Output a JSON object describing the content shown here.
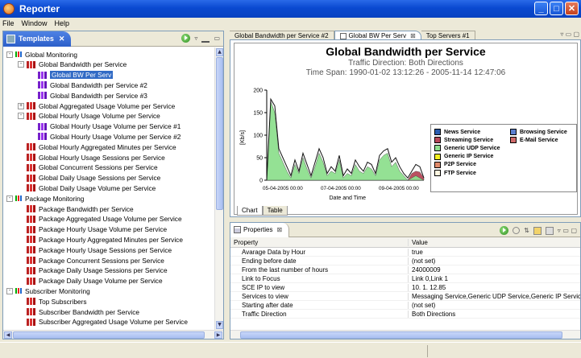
{
  "window": {
    "title": "Reporter"
  },
  "menu": [
    "File",
    "Window",
    "Help"
  ],
  "templates_panel": {
    "tab_label": "Templates",
    "tree": [
      {
        "label": "Global Monitoring",
        "level": 0,
        "icon": "folder",
        "expander": "-"
      },
      {
        "label": "Global Bandwidth per Service",
        "level": 1,
        "icon": "bar",
        "expander": "-"
      },
      {
        "label": "Global BW Per Serv",
        "level": 2,
        "icon": "violet",
        "selected": true
      },
      {
        "label": "Global Bandwidth per Service #2",
        "level": 2,
        "icon": "violet"
      },
      {
        "label": "Global Bandwidth per Service #3",
        "level": 2,
        "icon": "violet"
      },
      {
        "label": "Global Aggregated Usage Volume per Service",
        "level": 1,
        "icon": "bar",
        "expander": "+"
      },
      {
        "label": "Global Hourly Usage Volume per Service",
        "level": 1,
        "icon": "bar",
        "expander": "-"
      },
      {
        "label": "Global Hourly Usage Volume per Service #1",
        "level": 2,
        "icon": "violet"
      },
      {
        "label": "Global Hourly Usage Volume per Service #2",
        "level": 2,
        "icon": "violet"
      },
      {
        "label": "Global Hourly Aggregated Minutes per Service",
        "level": 1,
        "icon": "bar"
      },
      {
        "label": "Global Hourly Usage Sessions per Service",
        "level": 1,
        "icon": "bar"
      },
      {
        "label": "Global Concurrent Sessions per Service",
        "level": 1,
        "icon": "bar"
      },
      {
        "label": "Global Daily Usage Sessions per Service",
        "level": 1,
        "icon": "bar"
      },
      {
        "label": "Global Daily Usage Volume per Service",
        "level": 1,
        "icon": "bar"
      },
      {
        "label": "Package Monitoring",
        "level": 0,
        "icon": "folder",
        "expander": "-"
      },
      {
        "label": "Package Bandwidth per Service",
        "level": 1,
        "icon": "bar"
      },
      {
        "label": "Package Aggregated Usage Volume per Service",
        "level": 1,
        "icon": "bar"
      },
      {
        "label": "Package Hourly Usage Volume per Service",
        "level": 1,
        "icon": "bar"
      },
      {
        "label": "Package Hourly Aggregated Minutes per Service",
        "level": 1,
        "icon": "bar"
      },
      {
        "label": "Package Hourly Usage Sessions per Service",
        "level": 1,
        "icon": "bar"
      },
      {
        "label": "Package Concurrent Sessions per Service",
        "level": 1,
        "icon": "bar"
      },
      {
        "label": "Package Daily Usage Sessions per Service",
        "level": 1,
        "icon": "bar"
      },
      {
        "label": "Package Daily Usage Volume per Service",
        "level": 1,
        "icon": "bar"
      },
      {
        "label": "Subscriber Monitoring",
        "level": 0,
        "icon": "folder",
        "expander": "-"
      },
      {
        "label": "Top Subscribers",
        "level": 1,
        "icon": "bar"
      },
      {
        "label": "Subscriber Bandwidth per Service",
        "level": 1,
        "icon": "bar"
      },
      {
        "label": "Subscriber Aggregated Usage Volume per Service",
        "level": 1,
        "icon": "bar"
      }
    ]
  },
  "editor_tabs": [
    {
      "label": "Global Bandwidth per Service #2",
      "active": false
    },
    {
      "label": "Global BW Per Serv",
      "active": true
    },
    {
      "label": "Top Servers #1",
      "active": false
    }
  ],
  "chart_view_tabs": [
    {
      "label": "Chart",
      "active": true
    },
    {
      "label": "Table",
      "active": false
    }
  ],
  "chart_data": {
    "type": "area",
    "title": "Global Bandwidth per Service",
    "subtitle": "Traffic Direction: Both Directions",
    "time_span": "Time Span: 1990-01-02 13:12:26 - 2005-11-14 12:47:06",
    "xlabel": "Date and Time",
    "ylabel": "[Kb/s]",
    "ylim": [
      0,
      200
    ],
    "yticks": [
      0,
      50,
      100,
      150,
      200
    ],
    "xtick_labels": [
      "05-04-2005 00:00",
      "07-04-2005 00:00",
      "09-04-2005 00:00"
    ],
    "series": [
      {
        "name": "News Service",
        "color": "#2a5db0",
        "values": [
          0,
          0,
          0,
          0,
          0,
          0,
          0,
          0,
          0,
          0,
          0,
          0,
          0,
          0,
          0,
          0,
          0,
          0,
          0,
          0,
          0,
          0,
          0,
          0,
          0,
          0,
          0,
          0,
          0,
          0,
          0,
          0,
          0,
          0,
          0,
          0,
          0,
          0,
          0,
          0
        ]
      },
      {
        "name": "Browsing Service",
        "color": "#5a7fd0",
        "values": [
          0,
          0,
          0,
          0,
          0,
          0,
          0,
          0,
          0,
          0,
          0,
          0,
          0,
          0,
          0,
          0,
          0,
          0,
          0,
          0,
          0,
          0,
          0,
          0,
          0,
          0,
          0,
          0,
          0,
          0,
          0,
          0,
          0,
          0,
          0,
          0,
          0,
          0,
          0,
          0
        ]
      },
      {
        "name": "Streaming Service",
        "color": "#b8485a",
        "values": [
          0,
          0,
          0,
          0,
          0,
          0,
          0,
          0,
          0,
          0,
          0,
          0,
          0,
          0,
          0,
          0,
          0,
          0,
          0,
          0,
          0,
          0,
          0,
          0,
          0,
          0,
          0,
          0,
          0,
          0,
          0,
          0,
          0,
          0,
          0,
          0,
          15,
          20,
          18,
          5
        ]
      },
      {
        "name": "E-Mail Service",
        "color": "#d06a6a",
        "values": [
          0,
          0,
          0,
          0,
          0,
          0,
          0,
          0,
          0,
          0,
          0,
          0,
          0,
          0,
          0,
          0,
          0,
          0,
          0,
          0,
          0,
          0,
          0,
          0,
          0,
          0,
          0,
          0,
          0,
          0,
          0,
          0,
          0,
          0,
          0,
          0,
          0,
          0,
          0,
          0
        ]
      },
      {
        "name": "Generic UDP Service",
        "color": "#8fe08f",
        "values": [
          0,
          175,
          150,
          60,
          40,
          20,
          5,
          35,
          15,
          50,
          25,
          5,
          30,
          60,
          40,
          10,
          20,
          15,
          45,
          5,
          15,
          10,
          35,
          20,
          15,
          30,
          25,
          10,
          45,
          55,
          60,
          30,
          40,
          20,
          10,
          0,
          5,
          10,
          5,
          0
        ]
      },
      {
        "name": "Generic IP Service",
        "color": "#f4f020",
        "values": [
          0,
          0,
          0,
          0,
          0,
          0,
          0,
          0,
          0,
          0,
          0,
          0,
          0,
          0,
          0,
          0,
          0,
          0,
          0,
          0,
          0,
          0,
          0,
          0,
          0,
          0,
          0,
          0,
          0,
          0,
          0,
          0,
          0,
          0,
          0,
          0,
          0,
          0,
          0,
          0
        ]
      },
      {
        "name": "P2P Service",
        "color": "#e08a6a",
        "values": [
          0,
          0,
          0,
          0,
          0,
          0,
          0,
          0,
          0,
          0,
          0,
          0,
          0,
          0,
          0,
          0,
          0,
          0,
          0,
          0,
          0,
          0,
          0,
          0,
          0,
          0,
          0,
          0,
          0,
          0,
          0,
          0,
          0,
          0,
          0,
          0,
          0,
          0,
          0,
          0
        ]
      },
      {
        "name": "FTP Service",
        "color": "#fff7e0",
        "values": [
          0,
          0,
          0,
          0,
          0,
          0,
          0,
          0,
          0,
          0,
          0,
          0,
          0,
          0,
          0,
          0,
          0,
          0,
          0,
          0,
          0,
          0,
          0,
          0,
          0,
          0,
          0,
          0,
          0,
          0,
          0,
          0,
          0,
          0,
          0,
          0,
          0,
          0,
          0,
          0
        ]
      }
    ],
    "black_line": [
      0,
      180,
      165,
      70,
      50,
      30,
      10,
      45,
      20,
      60,
      35,
      10,
      40,
      70,
      50,
      15,
      30,
      20,
      55,
      10,
      25,
      15,
      45,
      30,
      20,
      40,
      35,
      15,
      55,
      65,
      70,
      40,
      50,
      30,
      15,
      5,
      20,
      35,
      30,
      5
    ],
    "legend_position": "right"
  },
  "properties": {
    "tab_label": "Properties",
    "columns": [
      "Property",
      "Value"
    ],
    "rows": [
      {
        "name": "Avarage Data by Hour",
        "value": "true"
      },
      {
        "name": "Ending before date",
        "value": "(not set)"
      },
      {
        "name": "From the last number of hours",
        "value": "24000009"
      },
      {
        "name": "Link to Focus",
        "value": "Link 0,Link 1"
      },
      {
        "name": "SCE IP to view",
        "value": "10. 1. 12.85"
      },
      {
        "name": "Services to view",
        "value": "Messaging Service,Generic UDP Service,Generic IP Service"
      },
      {
        "name": "Starting after date",
        "value": "(not set)"
      },
      {
        "name": "Traffic Direction",
        "value": "Both Directions"
      }
    ]
  }
}
